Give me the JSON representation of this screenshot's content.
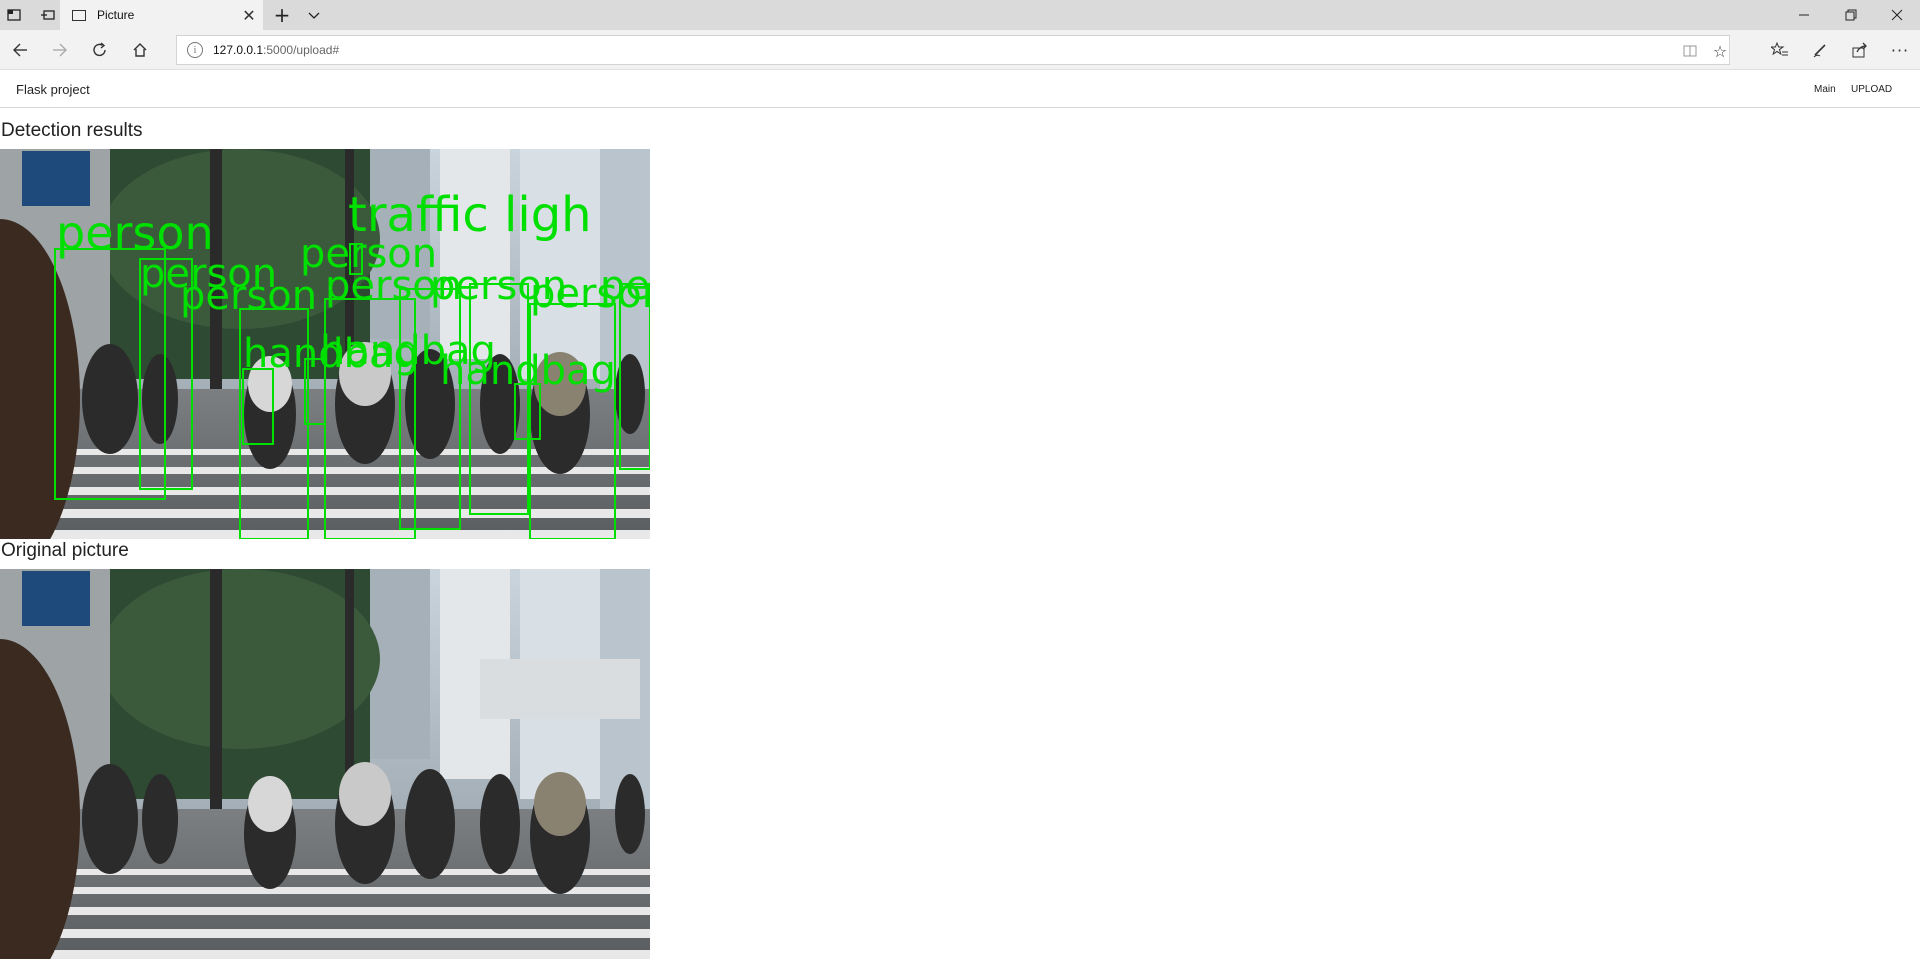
{
  "browser": {
    "tab_title": "Picture",
    "url_host": "127.0.0.1",
    "url_path": ":5000/upload#",
    "icons": {
      "tab_actions": "tab-actions-icon",
      "set_aside": "set-aside-tabs-icon",
      "back": "back-arrow-icon",
      "forward": "forward-arrow-icon",
      "refresh": "refresh-icon",
      "home": "home-icon",
      "site_info": "info-icon",
      "reading_view": "reading-view-icon",
      "favorite": "star-icon",
      "favorites_hub": "favorites-hub-icon",
      "pen": "pen-icon",
      "share": "share-icon",
      "more": "more-icon",
      "new_tab": "plus-icon",
      "tab_list": "chevron-down-icon",
      "minimize": "minimize-icon",
      "restore": "restore-icon",
      "close": "close-icon"
    }
  },
  "site": {
    "brand": "Flask project",
    "menu": [
      "Main",
      "UPLOAD"
    ]
  },
  "detection": {
    "title": "Detection results",
    "labels": [
      "person",
      "traffic ligh",
      "person",
      "person",
      "person",
      "person",
      "person",
      "person",
      "handbag",
      "handbag",
      "handbag",
      "person"
    ],
    "box_color": "#00e000"
  },
  "original": {
    "title": "Original picture"
  },
  "colors": {
    "detection_green": "#00e000",
    "chrome_bg": "#dadada",
    "toolbar_bg": "#f2f2f2"
  }
}
